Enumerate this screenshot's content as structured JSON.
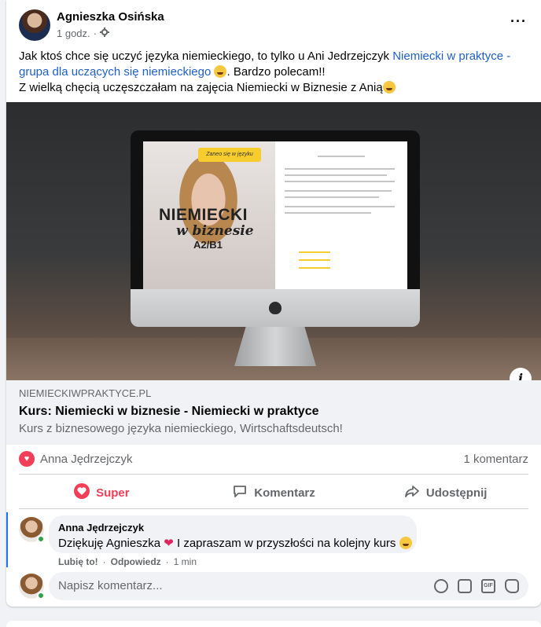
{
  "post": {
    "author": "Agnieszka Osińska",
    "time": "1 godz.",
    "privacy_icon": "gear-icon",
    "text_part1": "Jak ktoś chce  się uczyć języka niemieckiego,  to tylko u Ani Jedrzejczyk ",
    "group_link": "Niemiecki w praktyce - grupa dla uczących się niemieckiego",
    "text_part2": ". Bardzo polecam!!",
    "text_line3": "Z wielką chęcią uczęszczałam na zajęcia Niemiecki w Biznesie z Anią"
  },
  "media": {
    "screen_badge": "Zaneo się w języku",
    "screen_title": "NIEMIECKI",
    "screen_subtitle": "w biznesie",
    "screen_level": "A2/B1",
    "info_label": "i"
  },
  "link_preview": {
    "domain": "NIEMIECKIWPRAKTYCE.PL",
    "title": "Kurs: Niemiecki w biznesie - Niemiecki w praktyce",
    "description": "Kurs z biznesowego języka niemieckiego, Wirtschaftsdeutsch!"
  },
  "stats": {
    "reactor": "Anna Jędrzejczyk",
    "comments": "1 komentarz"
  },
  "actions": {
    "react": "Super",
    "comment": "Komentarz",
    "share": "Udostępnij"
  },
  "comment": {
    "author": "Anna Jędrzejczyk",
    "text_part1": "Dziękuję Agnieszka ",
    "text_part2": " I zapraszam w przyszłości na kolejny kurs ",
    "like": "Lubię to!",
    "reply": "Odpowiedz",
    "time": "1 min"
  },
  "write_comment": {
    "placeholder": "Napisz komentarz..."
  },
  "colors": {
    "link": "#1f60c9",
    "reaction": "#f33e58",
    "online": "#31a24c"
  }
}
